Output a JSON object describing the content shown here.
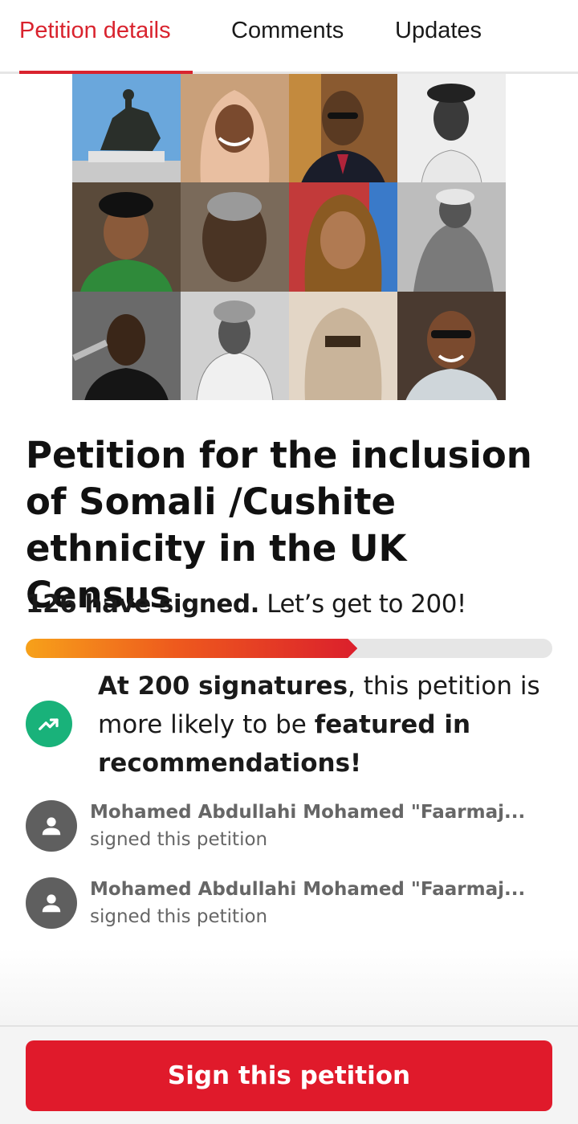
{
  "tabs": [
    {
      "label": "Petition details",
      "active": true
    },
    {
      "label": "Comments",
      "active": false
    },
    {
      "label": "Updates",
      "active": false
    }
  ],
  "petition": {
    "title": "Petition for the inclusion of Somali /Cushite ethnicity in the UK Census",
    "signed_count_text": "126 have signed.",
    "goal_text": " Let’s get to 200!",
    "signatures": 126,
    "goal": 200
  },
  "feature": {
    "bold1": "At 200 signatures",
    "text1": ", this petition is more likely to be ",
    "bold2": "featured in recommendations!"
  },
  "recent_signers": [
    {
      "name": "Mohamed Abdullahi Mohamed \"Faarmaj...",
      "action": "signed this petition"
    },
    {
      "name": "Mohamed Abdullahi Mohamed \"Faarmaj...",
      "action": "signed this petition"
    }
  ],
  "cta": {
    "label": "Sign this petition"
  },
  "colors": {
    "accent": "#d9232e",
    "button": "#e01a2b",
    "trend": "#19b27a"
  },
  "icons": {
    "trend": "trending-up-icon",
    "avatar": "person-icon"
  }
}
